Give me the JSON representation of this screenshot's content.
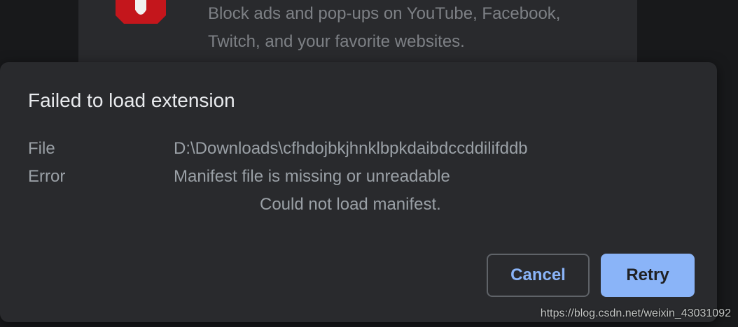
{
  "background": {
    "extension_description_line1": "Block ads and pop-ups on YouTube, Facebook,",
    "extension_description_line2": "Twitch, and your favorite websites."
  },
  "dialog": {
    "title": "Failed to load extension",
    "file_label": "File",
    "file_value": "D:\\Downloads\\cfhdojbkjhnklbpkdaibdccddilifddb",
    "error_label": "Error",
    "error_value": "Manifest file is missing or unreadable",
    "error_detail": "Could not load manifest.",
    "cancel_label": "Cancel",
    "retry_label": "Retry"
  },
  "watermark": "https://blog.csdn.net/weixin_43031092",
  "colors": {
    "accent": "#8ab4f8",
    "dialog_bg": "#292a2d",
    "page_bg": "#18191b",
    "logo_red": "#c4161c"
  },
  "icons": {
    "extension_logo": "adblock-hand-icon"
  }
}
